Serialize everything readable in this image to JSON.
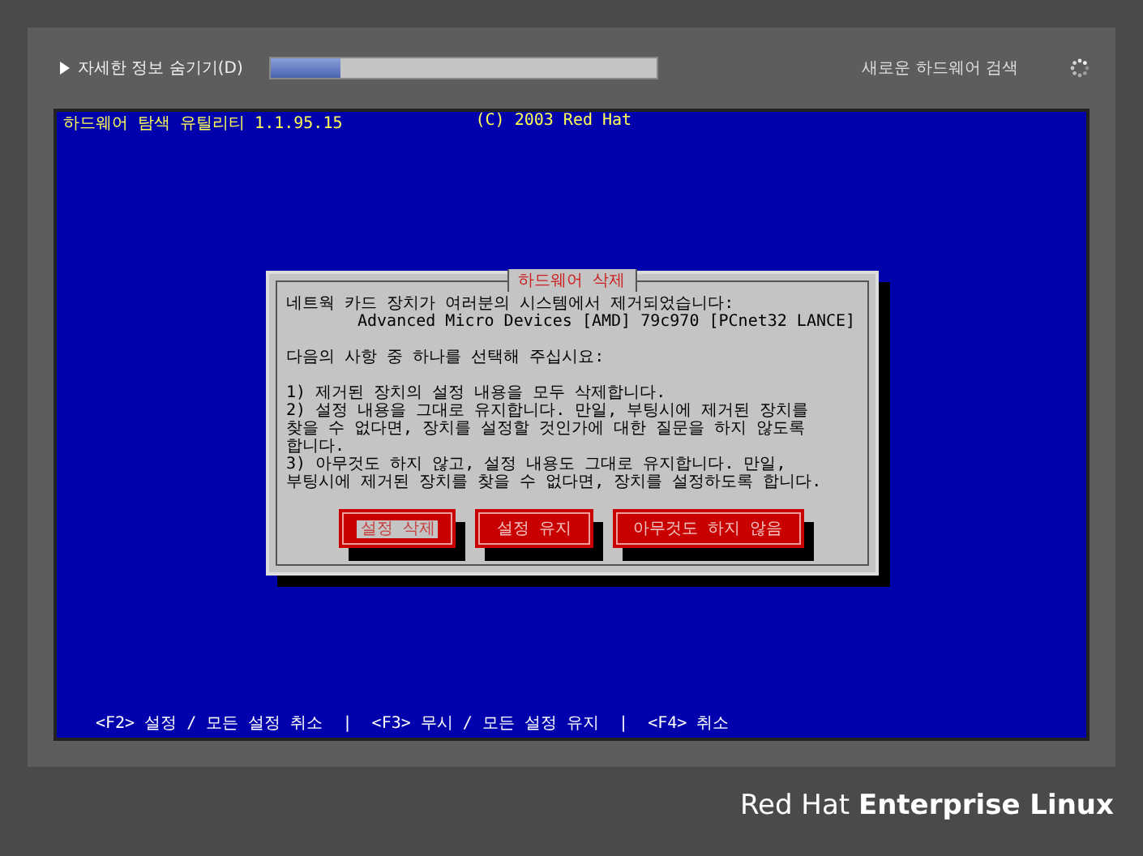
{
  "top_bar": {
    "details_toggle": "자세한 정보 숨기기(D)",
    "progress": {
      "level": 0.18
    },
    "status": "새로운 하드웨어 검색"
  },
  "console": {
    "title": "하드웨어 탐색 유틸리티 1.1.95.15",
    "copyright": "(C) 2003 Red Hat",
    "dialog": {
      "title": "하드웨어 삭제",
      "paragraphs": [
        [
          {
            "text": "네트웍 카드 장치가 여러분의 시스템에서 제거되었습니다:",
            "indent": false
          },
          {
            "text": "Advanced Micro Devices [AMD] 79c970 [PCnet32 LANCE]",
            "indent": true
          }
        ],
        [
          {
            "text": "다음의 사항 중 하나를 선택해 주십시요:",
            "indent": false
          }
        ],
        [
          {
            "text": "1) 제거된 장치의 설정 내용을 모두 삭제합니다.",
            "indent": false
          },
          {
            "text": "2) 설정 내용을 그대로 유지합니다. 만일, 부팅시에 제거된 장치를",
            "indent": false
          },
          {
            "text": "찾을 수 없다면, 장치를 설정할 것인가에 대한 질문을 하지 않도록",
            "indent": false
          },
          {
            "text": "합니다.",
            "indent": false
          },
          {
            "text": "3) 아무것도 하지 않고, 설정 내용도 그대로 유지합니다. 만일,",
            "indent": false
          },
          {
            "text": "부팅시에 제거된 장치를 찾을 수 없다면, 장치를 설정하도록 합니다.",
            "indent": false
          }
        ]
      ],
      "buttons": [
        {
          "label": "설정 삭제",
          "selected": true
        },
        {
          "label": "설정 유지",
          "selected": false
        },
        {
          "label": "아무것도 하지 않음",
          "selected": false
        }
      ]
    },
    "help_line": "<F2> 설정 / 모든 설정 취소  |  <F3> 무시 / 모든 설정 유지  |  <F4> 취소"
  },
  "brand": "Red Hat **Enterprise Linux**"
}
